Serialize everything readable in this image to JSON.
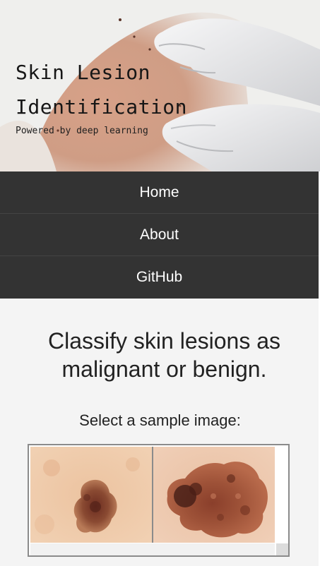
{
  "hero": {
    "title_line1": "Skin Lesion",
    "title_line2": "Identification",
    "subtitle": "Powered by deep learning"
  },
  "nav": {
    "items": [
      {
        "label": "Home"
      },
      {
        "label": "About"
      },
      {
        "label": "GitHub"
      }
    ]
  },
  "main": {
    "headline": "Classify skin lesions as malignant or benign.",
    "select_label": "Select a sample image:"
  },
  "colors": {
    "nav_background": "#333333",
    "nav_text": "#ffffff",
    "page_background": "#f4f4f4",
    "headline_text": "#222222"
  }
}
